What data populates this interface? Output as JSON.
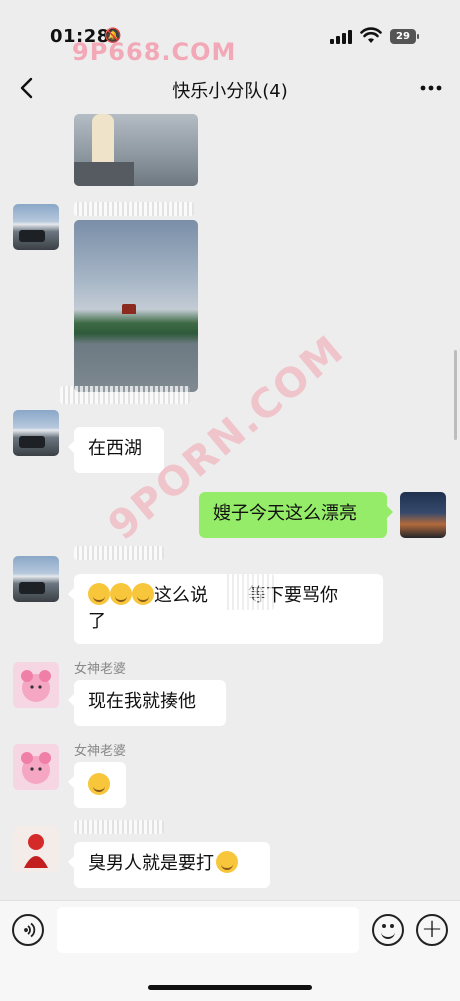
{
  "status": {
    "time": "01:28",
    "battery": "29"
  },
  "watermark": {
    "top": "9P668.COM",
    "middle": "9PORN.COM"
  },
  "nav": {
    "title": "快乐小分队(4)",
    "back_icon": "chevron-left-icon",
    "more_icon": "ellipsis-icon"
  },
  "messages": [
    {
      "type": "image",
      "side": "left",
      "desc": "lake-photo"
    },
    {
      "type": "image",
      "side": "left",
      "desc": "west-lake-photo"
    },
    {
      "type": "text",
      "side": "left",
      "text": "在西湖"
    },
    {
      "type": "text",
      "side": "right",
      "text": "嫂子今天这么漂亮"
    },
    {
      "type": "text",
      "side": "left",
      "text": "这么说",
      "text_end": "等下要骂你",
      "text_line2": "了"
    },
    {
      "type": "text",
      "side": "left",
      "nickname": "女神老婆",
      "text": "现在我就揍他"
    },
    {
      "type": "emoji",
      "side": "left",
      "nickname": "女神老婆"
    },
    {
      "type": "text",
      "side": "left",
      "text": "臭男人就是要打"
    }
  ],
  "input": {
    "placeholder": ""
  },
  "colors": {
    "background": "#ededed",
    "self_bubble": "#95ec69",
    "other_bubble": "#ffffff",
    "watermark": "#f4a5b5"
  }
}
